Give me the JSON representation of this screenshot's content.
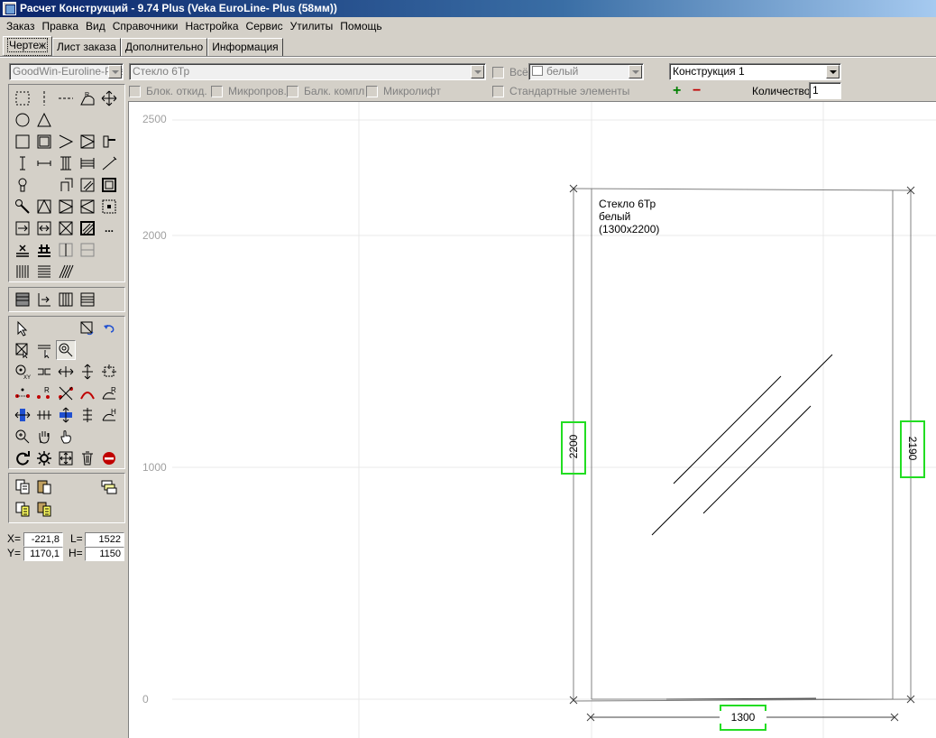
{
  "window": {
    "title": "Расчет Конструкций - 9.74 Plus (Veka EuroLine- Plus (58мм))"
  },
  "menu": [
    "Заказ",
    "Правка",
    "Вид",
    "Справочники",
    "Настройка",
    "Сервис",
    "Утилиты",
    "Помощь"
  ],
  "tabs": [
    "Чертеж",
    "Лист заказа",
    "Дополнительно",
    "Информация"
  ],
  "toolbar": {
    "profile_system": "GoodWin-Euroline-Plus",
    "glass": "Стекло 6Тр",
    "all_label": "Всё",
    "color": "белый",
    "construction": "Конструкция 1",
    "checkboxes": [
      "Блок. откид.",
      "Микропров.",
      "Балк. компл",
      "Микролифт"
    ],
    "standard_elements": "Стандартные элементы",
    "plus": "+",
    "minus": "−",
    "quantity_label": "Количество",
    "quantity": "1"
  },
  "coords": {
    "x_label": "X=",
    "x": "-221,8",
    "y_label": "Y=",
    "y": "1170,1",
    "l_label": "L=",
    "l": "1522",
    "h_label": "H=",
    "h": "1150"
  },
  "drawing": {
    "y_axis_ticks": [
      "2500",
      "2000",
      "1000",
      "0"
    ],
    "glass_label": [
      "Стекло 6Тр",
      "белый",
      "(1300x2200)"
    ],
    "dim_left": "2200",
    "dim_right": "2190",
    "dim_bottom": "1300",
    "highlight_color": "#22dd22"
  },
  "more_glyph": "..."
}
